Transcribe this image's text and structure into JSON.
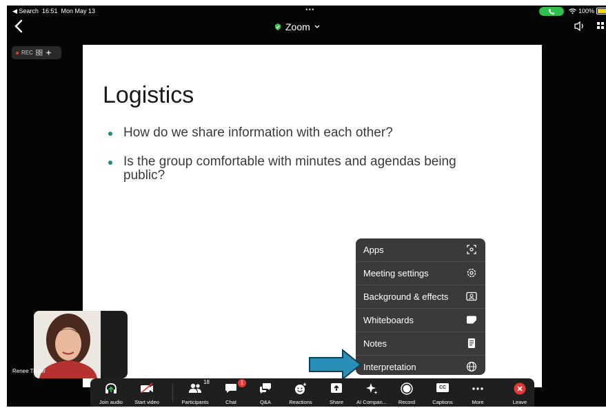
{
  "status_bar": {
    "back_app": "◀ Search",
    "time": "16:51",
    "date": "Mon May 13",
    "battery": "100%"
  },
  "nav": {
    "title": "Zoom"
  },
  "rec_indicator": {
    "label": "REC"
  },
  "slide": {
    "title": "Logistics",
    "bullets": [
      "How do we share information with each other?",
      "Is the group comfortable with minutes and agendas being public?"
    ]
  },
  "more_menu": {
    "items": [
      {
        "label": "Apps",
        "icon": "apps-icon"
      },
      {
        "label": "Meeting settings",
        "icon": "gear-icon"
      },
      {
        "label": "Background & effects",
        "icon": "person-frame-icon"
      },
      {
        "label": "Whiteboards",
        "icon": "whiteboard-icon"
      },
      {
        "label": "Notes",
        "icon": "notes-icon"
      },
      {
        "label": "Interpretation",
        "icon": "globe-icon"
      }
    ]
  },
  "self_view": {
    "name": "Renee Tinder"
  },
  "toolbar": {
    "join_audio": "Join audio",
    "start_video": "Start video",
    "participants": "Participants",
    "participants_count": "18",
    "chat": "Chat",
    "chat_badge": "1",
    "qa": "Q&A",
    "reactions": "Reactions",
    "share": "Share",
    "ai_companion": "AI Compan...",
    "record": "Record",
    "captions": "Captions",
    "captions_icon_text": "CC",
    "more": "More",
    "leave": "Leave"
  },
  "colors": {
    "accent_green": "#2ec04a",
    "bullet_teal": "#1f8a77",
    "leave_red": "#e53935",
    "arrow_blue": "#2a8fb8"
  }
}
